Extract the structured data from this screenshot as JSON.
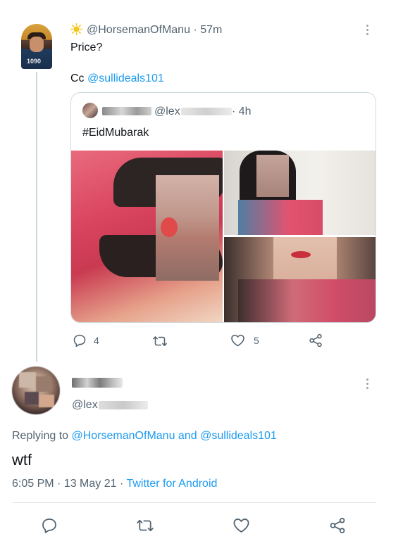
{
  "reply_tweet": {
    "badge_icon": "sun-emoji-icon",
    "handle": "@HorsemanOfManu",
    "separator": "·",
    "time": "57m",
    "text_line1": "Price?",
    "text_line2_prefix": "Cc",
    "mention": "@sullideals101",
    "avatar_shirt_text": "1090"
  },
  "quoted_tweet": {
    "handle_partial": "@lex",
    "separator": "·",
    "time": "4h",
    "text": "#EidMubarak"
  },
  "actions": {
    "reply_count": "4",
    "like_count": "5"
  },
  "main_tweet": {
    "handle_partial": "@lex",
    "replying_prefix": "Replying to",
    "reply_mention_1": "@HorsemanOfManu",
    "reply_and": "and",
    "reply_mention_2": "@sullideals101",
    "text": "wtf",
    "timestamp": "6:05 PM · 13 May 21 ·",
    "client": "Twitter for Android"
  },
  "colors": {
    "accent": "#1d9bf0",
    "secondary_text": "#536471",
    "border": "#cfd9de"
  }
}
